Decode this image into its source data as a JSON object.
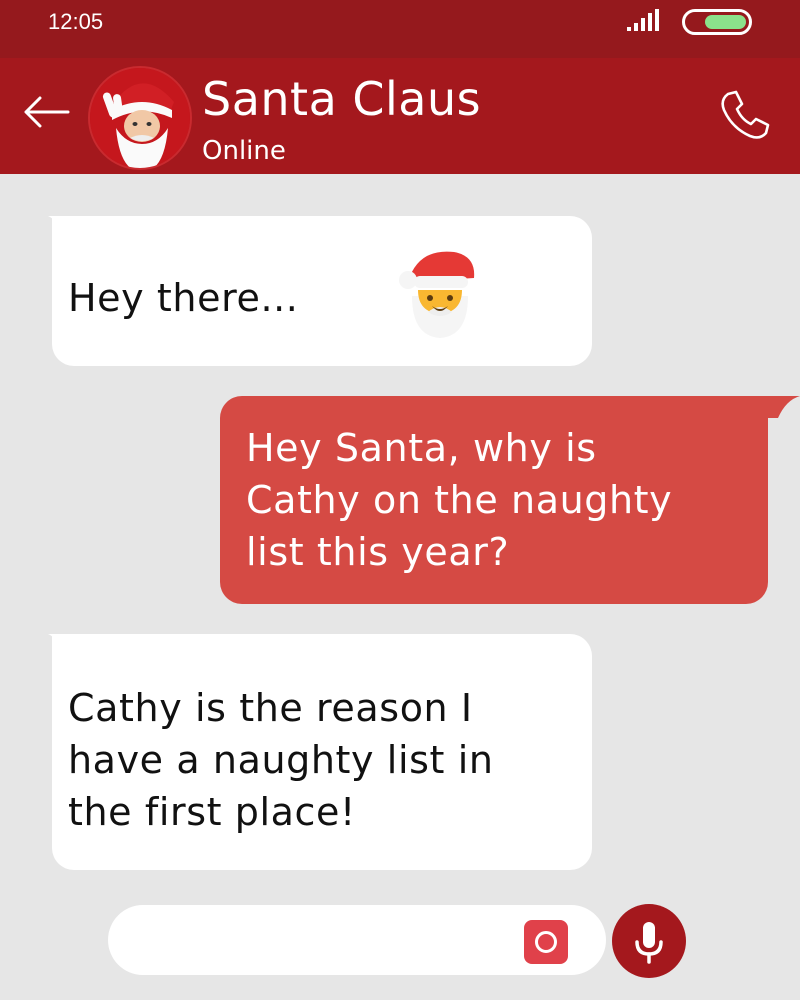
{
  "status_bar": {
    "time": "12:05",
    "signal_icon": "signal-bars-icon",
    "battery_icon": "battery-icon",
    "battery_color": "#8be28b"
  },
  "header": {
    "back_icon": "back-arrow-icon",
    "contact_name": "Santa Claus",
    "contact_status": "Online",
    "call_icon": "phone-icon",
    "background": "#a4181d"
  },
  "messages": [
    {
      "direction": "incoming",
      "text": "Hey there...",
      "emoji": "santa-face-emoji"
    },
    {
      "direction": "outgoing",
      "lines": [
        "Hey Santa, why is",
        "Cathy on the naughty",
        "list this year?"
      ]
    },
    {
      "direction": "incoming",
      "lines": [
        "Cathy is the reason I",
        "have a naughty list in",
        "the first place!"
      ]
    }
  ],
  "composer": {
    "input_value": "",
    "camera_icon": "camera-icon",
    "camera_color": "#e0414a",
    "mic_icon": "microphone-icon"
  },
  "colors": {
    "outgoing_bubble": "#d54a44",
    "incoming_bubble": "#ffffff",
    "background": "#e6e6e6"
  }
}
